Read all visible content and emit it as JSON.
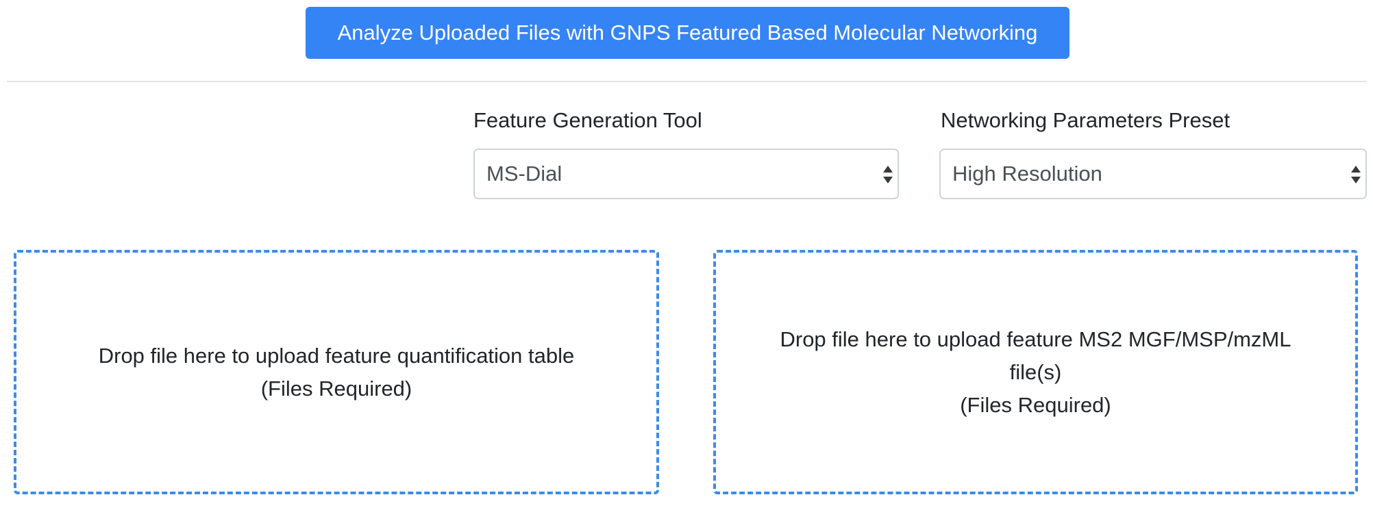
{
  "analyze_button": {
    "label": "Analyze Uploaded Files with GNPS Featured Based Molecular Networking"
  },
  "feature_tool": {
    "label": "Feature Generation Tool",
    "value": "MS-Dial"
  },
  "network_preset": {
    "label": "Networking Parameters Preset",
    "value": "High Resolution"
  },
  "dropzones": [
    {
      "lines": [
        "Drop file here to upload feature quantification table",
        "(Files Required)"
      ]
    },
    {
      "lines": [
        "Drop file here to upload feature MS2 MGF/MSP/mzML",
        "file(s)",
        "(Files Required)"
      ]
    }
  ],
  "colors": {
    "primary_button": "#3584f5",
    "dropzone_border": "#3d8be6",
    "select_border": "#ced4da"
  },
  "icons": {
    "select_arrows": "up-down-caret-icon"
  }
}
